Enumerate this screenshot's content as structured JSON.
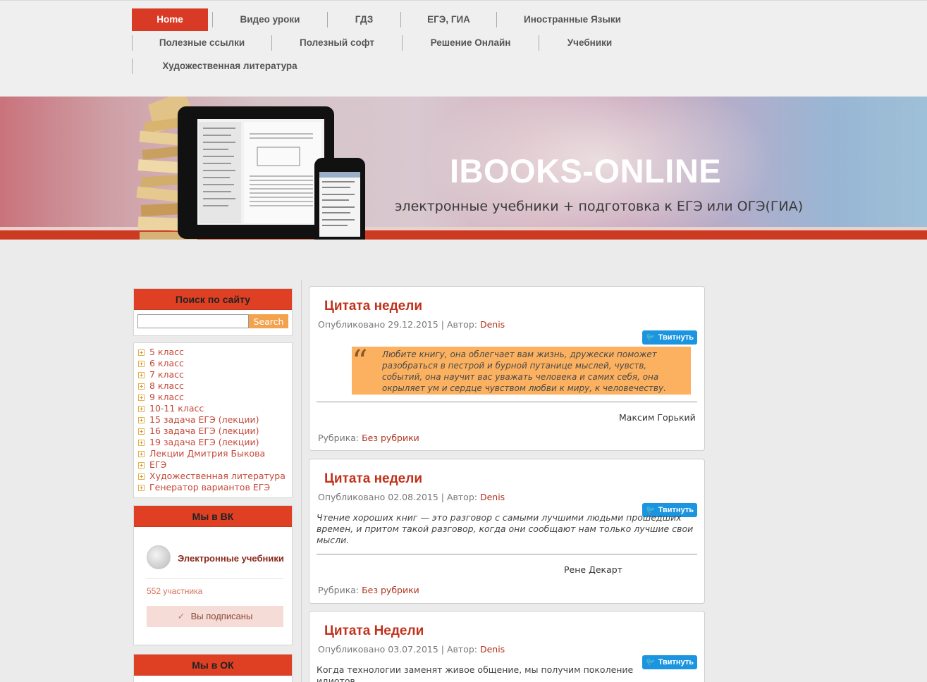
{
  "nav": {
    "items": [
      {
        "label": "Home",
        "active": true
      },
      {
        "label": "Видео уроки"
      },
      {
        "label": "ГДЗ"
      },
      {
        "label": "ЕГЭ, ГИА"
      },
      {
        "label": "Иностранные Языки"
      },
      {
        "label": "Полезные ссылки"
      },
      {
        "label": "Полезный софт"
      },
      {
        "label": "Решение Онлайн"
      },
      {
        "label": "Учебники"
      },
      {
        "label": "Художественная литература"
      }
    ]
  },
  "banner": {
    "title": "IBOOKS-ONLINE",
    "subtitle": "электронные учебники + подготовка к ЕГЭ или ОГЭ(ГИА)"
  },
  "sidebar": {
    "search": {
      "title": "Поиск по сайту",
      "placeholder": "",
      "button": "Search"
    },
    "categories": [
      "5 класс",
      "6 класс",
      "7 класс",
      "8 класс",
      "9 класс",
      "10-11 класс",
      "15 задача ЕГЭ (лекции)",
      "16 задача ЕГЭ (лекции)",
      "19 задача ЕГЭ (лекции)",
      "Лекции Дмитрия Быкова",
      "ЕГЭ",
      "Художественная литература",
      "Генератор вариантов ЕГЭ"
    ],
    "vk": {
      "title": "Мы в ВК",
      "group_name": "Электронные учебники",
      "members": "552 участника",
      "subscribed": "Вы подписаны"
    },
    "ok": {
      "title": "Мы в ОК"
    }
  },
  "tweet_label": "Твитнуть",
  "posts": [
    {
      "title": "Цитата недели",
      "meta_prefix": "Опубликовано 29.12.2015 | Автор: ",
      "author": "Denis",
      "text": "Любите книгу, она облегчает вам жизнь, дружески поможет разобраться в пестрой и бурной путанице мыслей, чувств, событий, она научит вас уважать человека и самих себя, она окрыляет ум и сердце чувством любви к миру, к человечеству.",
      "signature": "Максим Горький",
      "rubric_label": "Рубрика: ",
      "rubric": "Без рубрики"
    },
    {
      "title": "Цитата недели",
      "meta_prefix": "Опубликовано 02.08.2015 | Автор: ",
      "author": "Denis",
      "text": "Чтение хороших книг — это разговор с самыми лучшими людьми прошедших времен, и притом такой разговор, когда они сообщают нам только лучшие свои мысли.",
      "signature": "Рене Декарт",
      "rubric_label": "Рубрика: ",
      "rubric": "Без рубрики"
    },
    {
      "title": "Цитата Недели",
      "meta_prefix": "Опубликовано 03.07.2015 | Автор: ",
      "author": "Denis",
      "text": "Когда технологии заменят живое общение, мы получим поколение идиотов."
    }
  ],
  "colors": {
    "accent": "#d93a25",
    "quote_bg": "#fbb15f",
    "tweet": "#1b95e0"
  }
}
